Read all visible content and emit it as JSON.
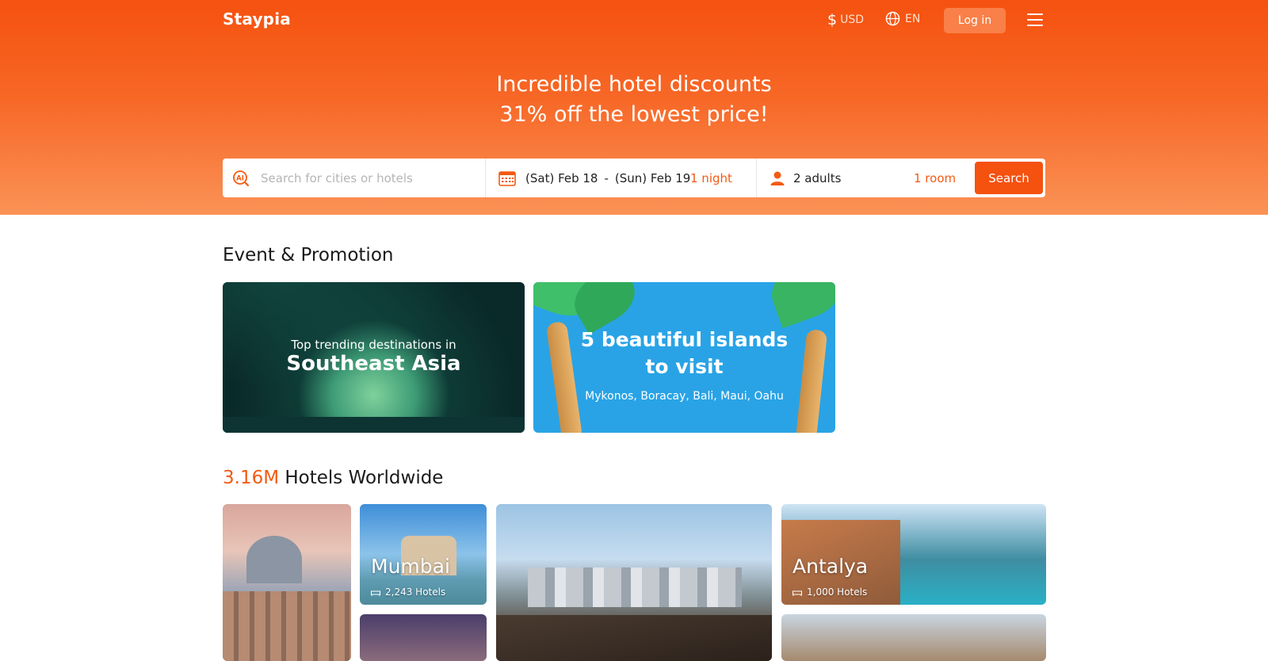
{
  "brand": {
    "logo": "Staypia"
  },
  "header": {
    "currency_symbol": "$",
    "currency": "USD",
    "language": "EN",
    "login_label": "Log in",
    "icons": [
      "globe-icon",
      "menu-icon"
    ]
  },
  "hero": {
    "line1": "Incredible hotel discounts",
    "line2": "31% off the lowest price!"
  },
  "search": {
    "placeholder": "Search for cities or hotels",
    "checkin": "(Sat) Feb 18",
    "separator": "-",
    "checkout": "(Sun) Feb 19",
    "nights": "1 night",
    "guests": "2 adults",
    "rooms": "1 room",
    "button_label": "Search",
    "icons": [
      "ai-search-icon",
      "calendar-icon",
      "person-icon"
    ]
  },
  "promotions": {
    "title": "Event & Promotion",
    "cards": [
      {
        "subtitle": "Top trending destinations in",
        "title": "Southeast Asia"
      },
      {
        "title_line1": "5 beautiful islands",
        "title_line2": "to visit",
        "subtitle": "Mykonos, Boracay, Bali, Maui, Oahu"
      }
    ]
  },
  "hotels": {
    "count": "3.16M",
    "title": "Hotels Worldwide",
    "tiles": [
      {
        "name": "Mumbai",
        "count": "2,243 Hotels"
      },
      {
        "name": "Antalya",
        "count": "1,000 Hotels"
      }
    ]
  },
  "colors": {
    "brand": "#f5510f",
    "accent_text": "#f35a12"
  }
}
